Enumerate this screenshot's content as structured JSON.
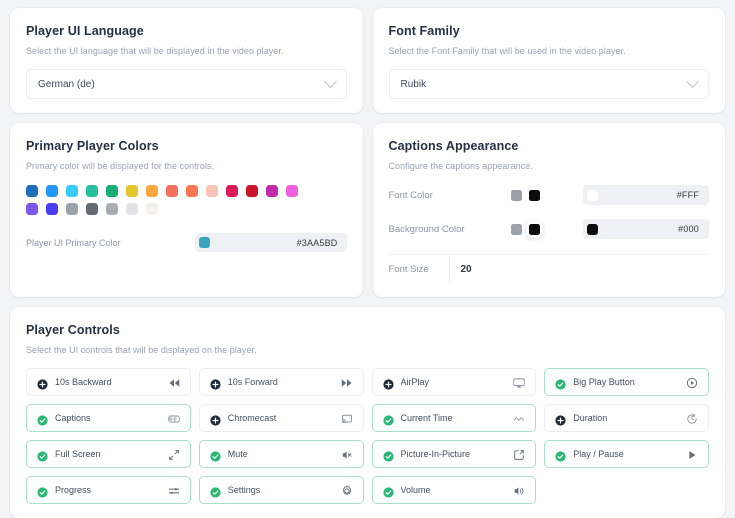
{
  "accents": {
    "green": "#2bb673",
    "dark": "#1f2a3c",
    "primary_teal": "#3aa5bd"
  },
  "language_card": {
    "title": "Player UI Language",
    "subtitle": "Select the UI language that will be displayed in the video player.",
    "select_value": "German (de)"
  },
  "font_family_card": {
    "title": "Font Family",
    "subtitle": "Select the Font Family that will be used in the video player.",
    "select_value": "Rubik"
  },
  "colors_card": {
    "title": "Primary Player Colors",
    "subtitle": "Primary color will be displayed for the controls.",
    "swatch_rows": [
      [
        "#1d6fb8",
        "#2196f3",
        "#35cdf5",
        "#27bfa0",
        "#16ae75",
        "#e6c52e",
        "#f7a73c",
        "#f4705c",
        "#f7784f",
        "#f8c3b7",
        "#e01a58",
        "#c8152a",
        "#c32bab",
        "#f062dd"
      ],
      [
        "#7b57e8",
        "#4a3cf0",
        "#9ba1a8",
        "#636a72",
        "#a8adb4",
        "#e1e3e6",
        "#f3f1ee"
      ]
    ],
    "primary_label": "Player UI Primary Color",
    "primary_hex": "#3AA5BD",
    "primary_swatch": "#3aa5bd"
  },
  "captions_card": {
    "title": "Captions Appearance",
    "subtitle": "Configure the captions appearance.",
    "rows": [
      {
        "label": "Font Color",
        "chip_a": "#9ba1a8",
        "chip_b": "#0c0c0c",
        "selected": "b",
        "field_chip": "#ffffff",
        "hex": "#FFF"
      },
      {
        "label": "Background Color",
        "chip_a": "#9ba1a8",
        "chip_b": "#0c0c0c",
        "selected": "b",
        "field_chip": "#0c0c0c",
        "hex": "#000"
      }
    ],
    "font_size_label": "Font Size",
    "font_size_value": "20"
  },
  "controls_card": {
    "title": "Player Controls",
    "subtitle": "Select the UI controls that will be displayed on the player.",
    "items": [
      {
        "label": "10s Backward",
        "enabled": false,
        "icon": "rewind-icon"
      },
      {
        "label": "10s Forward",
        "enabled": false,
        "icon": "fast-forward-icon"
      },
      {
        "label": "AirPlay",
        "enabled": false,
        "icon": "airplay-icon"
      },
      {
        "label": "Big Play Button",
        "enabled": true,
        "icon": "play-circle-icon"
      },
      {
        "label": "Captions",
        "enabled": true,
        "icon": "captions-icon"
      },
      {
        "label": "Chromecast",
        "enabled": false,
        "icon": "chromecast-icon"
      },
      {
        "label": "Current Time",
        "enabled": true,
        "icon": "wave-icon"
      },
      {
        "label": "Duration",
        "enabled": false,
        "icon": "clock-icon"
      },
      {
        "label": "Full Screen",
        "enabled": true,
        "icon": "fullscreen-icon"
      },
      {
        "label": "Mute",
        "enabled": true,
        "icon": "mute-icon"
      },
      {
        "label": "Picture-In-Picture",
        "enabled": true,
        "icon": "pip-icon"
      },
      {
        "label": "Play / Pause",
        "enabled": true,
        "icon": "play-icon"
      },
      {
        "label": "Progress",
        "enabled": true,
        "icon": "progress-icon"
      },
      {
        "label": "Settings",
        "enabled": true,
        "icon": "gear-icon"
      },
      {
        "label": "Volume",
        "enabled": true,
        "icon": "volume-icon"
      }
    ]
  }
}
